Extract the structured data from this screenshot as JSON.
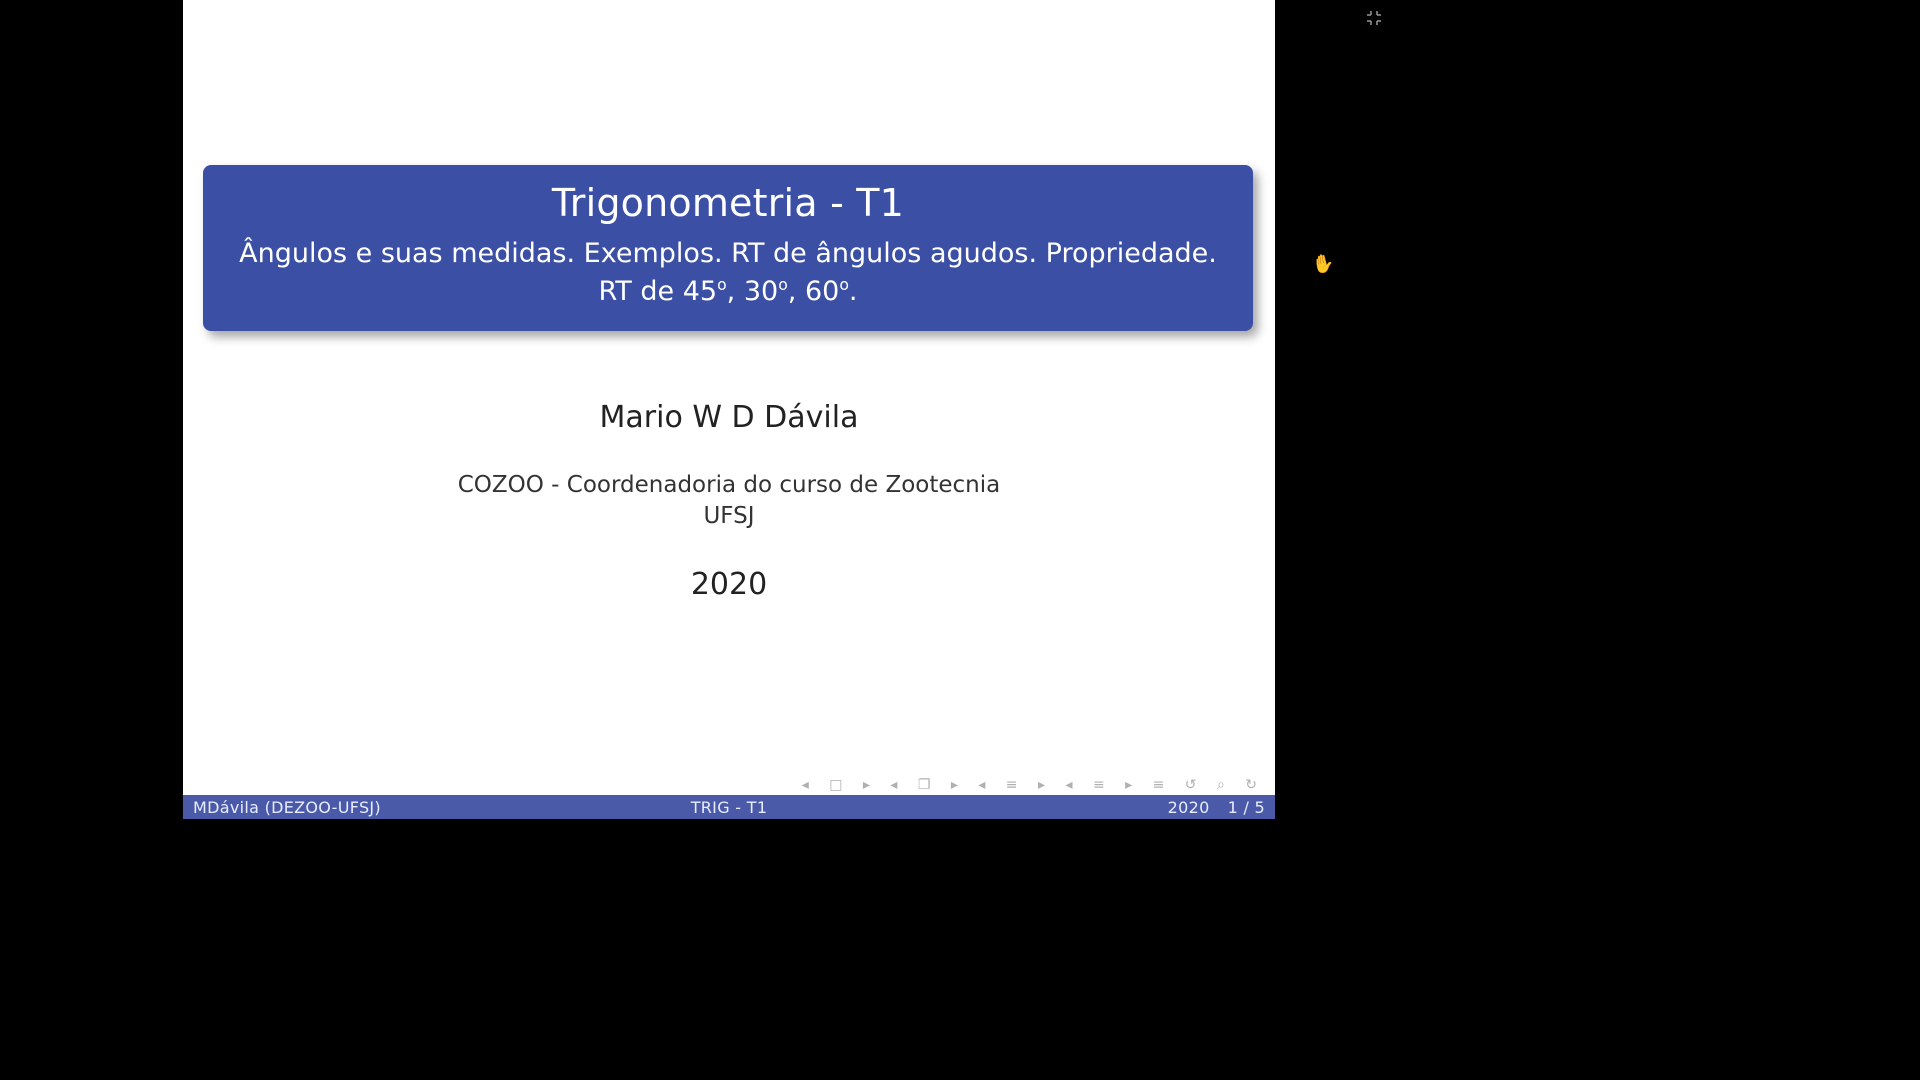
{
  "title_block": {
    "title": "Trigonometria - T1",
    "subtitle_line1": "Ângulos e suas medidas.  Exemplos.  RT de ângulos agudos.  Propriedade.",
    "subtitle_line2_prefix": "RT de 45",
    "subtitle_line2_mid1": ", 30",
    "subtitle_line2_mid2": ", 60",
    "subtitle_line2_suffix": ".",
    "degree_symbol": "o"
  },
  "author": "Mario W D Dávila",
  "institute_line1": "COZOO - Coordenadoria do curso de Zootecnia",
  "institute_line2": "UFSJ",
  "date": "2020",
  "footer": {
    "left": "MDávila  (DEZOO-UFSJ)",
    "center": "TRIG - T1",
    "right_year": "2020",
    "right_page": "1 / 5"
  },
  "nav_glyphs": {
    "first": "◂ □ ▸",
    "prev": "◂ ❐ ▸",
    "lines1": "◂ ≡ ▸",
    "lines2": "◂ ≡ ▸",
    "plain": "≡",
    "cycle": "↺ ⌕ ↻"
  }
}
